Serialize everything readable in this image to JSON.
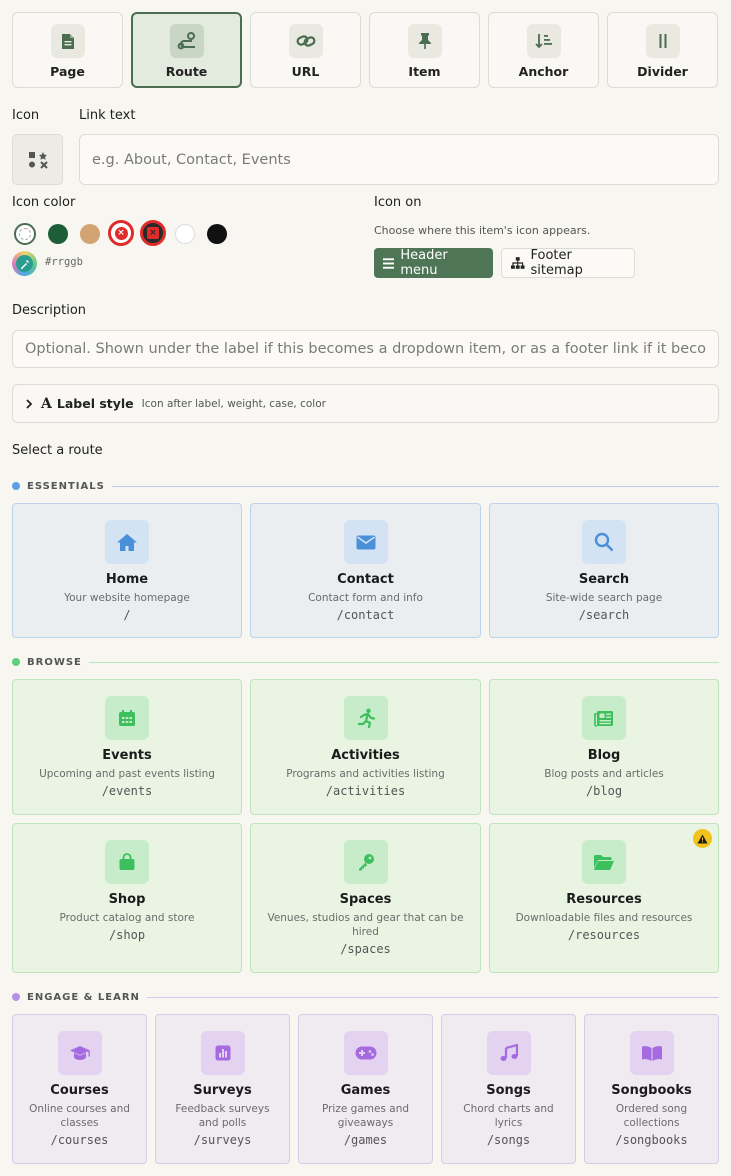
{
  "types": [
    {
      "label": "Page",
      "icon": "page-icon"
    },
    {
      "label": "Route",
      "icon": "route-icon",
      "active": true
    },
    {
      "label": "URL",
      "icon": "link-icon"
    },
    {
      "label": "Item",
      "icon": "pin-icon"
    },
    {
      "label": "Anchor",
      "icon": "anchor-sort-icon"
    },
    {
      "label": "Divider",
      "icon": "divider-icon"
    }
  ],
  "form": {
    "icon_label": "Icon",
    "link_text_label": "Link text",
    "link_text_placeholder": "e.g. About, Contact, Events",
    "icon_color_label": "Icon color",
    "hex_placeholder": "#rrggb",
    "icon_on_label": "Icon on",
    "icon_on_help": "Choose where this item's icon appears.",
    "header_menu": "Header menu",
    "footer_sitemap": "Footer sitemap",
    "description_label": "Description",
    "description_placeholder": "Optional. Shown under the label if this becomes a dropdown item, or as a footer link if it becomes",
    "label_style_title": "Label style",
    "label_style_sub": "Icon after label, weight, case, color",
    "select_route_label": "Select a route"
  },
  "colors": {
    "accent": "#4e7555",
    "swatches": [
      "none",
      "#1d5d37",
      "#d2a472",
      "#e02b2b",
      "#2a2a2a",
      "#ffffff",
      "#111111"
    ]
  },
  "sections": {
    "essentials": {
      "title": "ESSENTIALS",
      "color": "#5b9ee6"
    },
    "browse": {
      "title": "BROWSE",
      "color": "#61cf7a"
    },
    "engage": {
      "title": "ENGAGE & LEARN",
      "color": "#b590e4"
    }
  },
  "routes": {
    "essentials": [
      {
        "title": "Home",
        "desc": "Your website homepage",
        "path": "/",
        "icon": "home-icon"
      },
      {
        "title": "Contact",
        "desc": "Contact form and info",
        "path": "/contact",
        "icon": "mail-icon"
      },
      {
        "title": "Search",
        "desc": "Site-wide search page",
        "path": "/search",
        "icon": "search-icon"
      }
    ],
    "browse": [
      {
        "title": "Events",
        "desc": "Upcoming and past events listing",
        "path": "/events",
        "icon": "calendar-icon"
      },
      {
        "title": "Activities",
        "desc": "Programs and activities listing",
        "path": "/activities",
        "icon": "running-icon"
      },
      {
        "title": "Blog",
        "desc": "Blog posts and articles",
        "path": "/blog",
        "icon": "newspaper-icon"
      },
      {
        "title": "Shop",
        "desc": "Product catalog and store",
        "path": "/shop",
        "icon": "shopping-bag-icon"
      },
      {
        "title": "Spaces",
        "desc": "Venues, studios and gear that can be hired",
        "path": "/spaces",
        "icon": "key-icon"
      },
      {
        "title": "Resources",
        "desc": "Downloadable files and resources",
        "path": "/resources",
        "icon": "folder-icon"
      }
    ],
    "engage": [
      {
        "title": "Courses",
        "desc": "Online courses and classes",
        "path": "/courses",
        "icon": "graduation-cap-icon"
      },
      {
        "title": "Surveys",
        "desc": "Feedback surveys and polls",
        "path": "/surveys",
        "icon": "poll-icon"
      },
      {
        "title": "Games",
        "desc": "Prize games and giveaways",
        "path": "/games",
        "icon": "gamepad-icon"
      },
      {
        "title": "Songs",
        "desc": "Chord charts and lyrics",
        "path": "/songs",
        "icon": "music-icon"
      },
      {
        "title": "Songbooks",
        "desc": "Ordered song collections",
        "path": "/songbooks",
        "icon": "book-icon"
      }
    ]
  }
}
